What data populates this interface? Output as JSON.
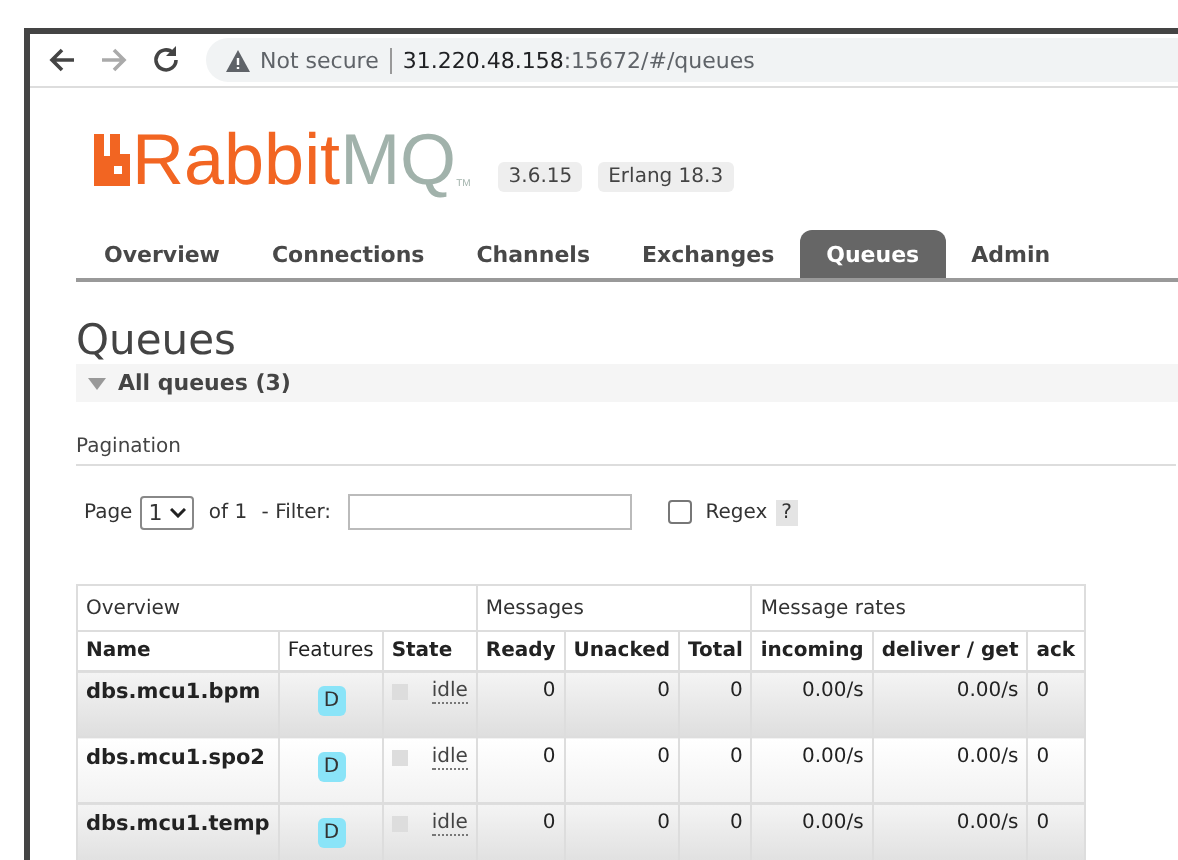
{
  "browser": {
    "security": "Not secure",
    "url_host": "31.220.48.158",
    "url_path": ":15672/#/queues"
  },
  "logo": {
    "word_a": "Rabbit",
    "word_b": "MQ",
    "mark": "TM"
  },
  "versions": [
    "3.6.15",
    "Erlang 18.3"
  ],
  "tabs": [
    {
      "label": "Overview",
      "selected": false
    },
    {
      "label": "Connections",
      "selected": false
    },
    {
      "label": "Channels",
      "selected": false
    },
    {
      "label": "Exchanges",
      "selected": false
    },
    {
      "label": "Queues",
      "selected": true
    },
    {
      "label": "Admin",
      "selected": false
    }
  ],
  "heading": "Queues",
  "section": {
    "title": "All queues (3)",
    "expanded": true
  },
  "pagination": {
    "title": "Pagination",
    "page_label": "Page",
    "page_value": "1",
    "of_label": "of 1",
    "filter_label": "- Filter:",
    "regex": {
      "label": "Regex",
      "checked": false
    },
    "help": "?"
  },
  "table": {
    "groups": [
      {
        "label": "Overview"
      },
      {
        "label": "Messages"
      },
      {
        "label": "Message rates"
      }
    ],
    "columns": [
      {
        "label": "Name",
        "bold": true
      },
      {
        "label": "Features",
        "bold": false
      },
      {
        "label": "State",
        "bold": true
      },
      {
        "label": "Ready",
        "bold": true
      },
      {
        "label": "Unacked",
        "bold": true
      },
      {
        "label": "Total",
        "bold": true
      },
      {
        "label": "incoming",
        "bold": true
      },
      {
        "label": "deliver / get",
        "bold": true
      },
      {
        "label": "ack",
        "bold": true
      }
    ],
    "rows": [
      {
        "name": "dbs.mcu1.bpm",
        "feature": "D",
        "state": "idle",
        "ready": "0",
        "unacked": "0",
        "total": "0",
        "incoming": "0.00/s",
        "deliver_get": "0.00/s",
        "ack": "0"
      },
      {
        "name": "dbs.mcu1.spo2",
        "feature": "D",
        "state": "idle",
        "ready": "0",
        "unacked": "0",
        "total": "0",
        "incoming": "0.00/s",
        "deliver_get": "0.00/s",
        "ack": "0"
      },
      {
        "name": "dbs.mcu1.temp",
        "feature": "D",
        "state": "idle",
        "ready": "0",
        "unacked": "0",
        "total": "0",
        "incoming": "0.00/s",
        "deliver_get": "0.00/s",
        "ack": "0"
      }
    ]
  }
}
